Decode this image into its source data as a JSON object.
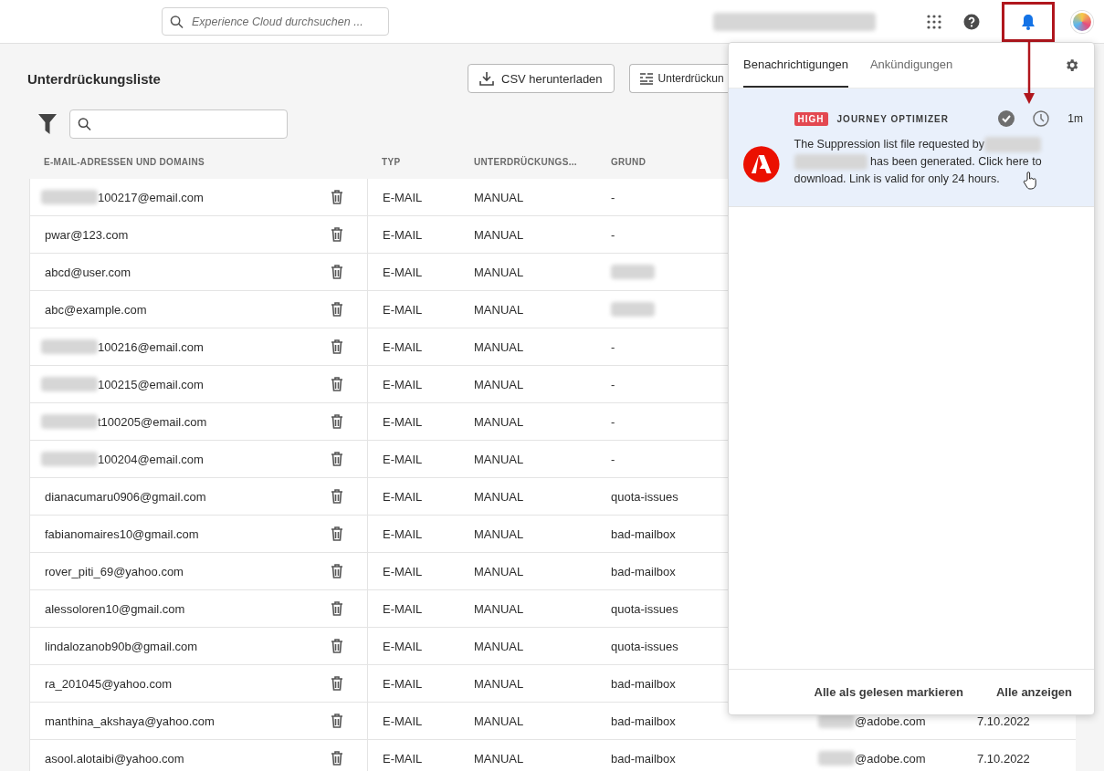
{
  "top_bar": {
    "search": {
      "placeholder": "Experience Cloud durchsuchen ..."
    },
    "account_redacted": true,
    "bell_highlighted": true
  },
  "page": {
    "title": "Unterdrückungsliste",
    "buttons": [
      {
        "label": "CSV herunterladen",
        "kind": "download"
      },
      {
        "label": "Unterdrückun",
        "kind": "settings"
      }
    ]
  },
  "table": {
    "columns": [
      "E-MAIL-ADRESSEN UND DOMAINS",
      "TYP",
      "UNTERDRÜCKUNGS...",
      "GRUND"
    ],
    "rows": [
      {
        "email": "100217@email.com",
        "email_redacted": true,
        "type": "E-MAIL",
        "suppression": "MANUAL",
        "reason": "-",
        "reason_redacted": false
      },
      {
        "email": "pwar@123.com",
        "email_redacted": false,
        "type": "E-MAIL",
        "suppression": "MANUAL",
        "reason": "-",
        "reason_redacted": false
      },
      {
        "email": "abcd@user.com",
        "email_redacted": false,
        "type": "E-MAIL",
        "suppression": "MANUAL",
        "reason_redacted": true
      },
      {
        "email": "abc@example.com",
        "email_redacted": false,
        "type": "E-MAIL",
        "suppression": "MANUAL",
        "reason_redacted": true
      },
      {
        "email": "100216@email.com",
        "email_redacted": true,
        "type": "E-MAIL",
        "suppression": "MANUAL",
        "reason": "-",
        "reason_redacted": false
      },
      {
        "email": "100215@email.com",
        "email_redacted": true,
        "type": "E-MAIL",
        "suppression": "MANUAL",
        "reason": "-",
        "reason_redacted": false
      },
      {
        "email": "t100205@email.com",
        "email_redacted": true,
        "type": "E-MAIL",
        "suppression": "MANUAL",
        "reason": "-",
        "reason_redacted": false
      },
      {
        "email": "100204@email.com",
        "email_redacted": true,
        "type": "E-MAIL",
        "suppression": "MANUAL",
        "reason": "-",
        "reason_redacted": false
      },
      {
        "email": "dianacumaru0906@gmail.com",
        "email_redacted": false,
        "type": "E-MAIL",
        "suppression": "MANUAL",
        "reason": "quota-issues",
        "reason_redacted": false
      },
      {
        "email": "fabianomaires10@gmail.com",
        "email_redacted": false,
        "type": "E-MAIL",
        "suppression": "MANUAL",
        "reason": "bad-mailbox",
        "reason_redacted": false
      },
      {
        "email": "rover_piti_69@yahoo.com",
        "email_redacted": false,
        "type": "E-MAIL",
        "suppression": "MANUAL",
        "reason": "bad-mailbox",
        "reason_redacted": false
      },
      {
        "email": "alessoloren10@gmail.com",
        "email_redacted": false,
        "type": "E-MAIL",
        "suppression": "MANUAL",
        "reason": "quota-issues",
        "reason_redacted": false
      },
      {
        "email": "lindalozanob90b@gmail.com",
        "email_redacted": false,
        "type": "E-MAIL",
        "suppression": "MANUAL",
        "reason": "quota-issues",
        "reason_redacted": false
      },
      {
        "email": "ra_201045@yahoo.com",
        "email_redacted": false,
        "type": "E-MAIL",
        "suppression": "MANUAL",
        "reason": "bad-mailbox",
        "reason_redacted": false
      },
      {
        "email": "manthina_akshaya@yahoo.com",
        "email_redacted": false,
        "type": "E-MAIL",
        "suppression": "MANUAL",
        "reason": "bad-mailbox",
        "reason_redacted": false,
        "column_5": "@adobe.com",
        "column_5_redacted": true,
        "column_6": "7.10.2022"
      },
      {
        "email": "asool.alotaibi@yahoo.com",
        "email_redacted": false,
        "type": "E-MAIL",
        "suppression": "MANUAL",
        "reason": "bad-mailbox",
        "reason_redacted": false,
        "column_5": "@adobe.com",
        "column_5_redacted": true,
        "column_6": "7.10.2022"
      }
    ]
  },
  "notifications_panel": {
    "tabs": [
      {
        "label": "Benachrichtigungen",
        "selected": true
      },
      {
        "label": "Ankündigungen",
        "selected": false
      }
    ],
    "items": [
      {
        "priority": "HIGH",
        "source": "JOURNEY OPTIMIZER",
        "read": true,
        "time": "1m",
        "message_start": "The Suppression list file requested by",
        "message_end": "has been generated. Click here to download. Link is valid for only 24 hours.",
        "requester_redacted": true
      }
    ],
    "footer": [
      "Alle als gelesen markieren",
      "Alle anzeigen"
    ]
  }
}
